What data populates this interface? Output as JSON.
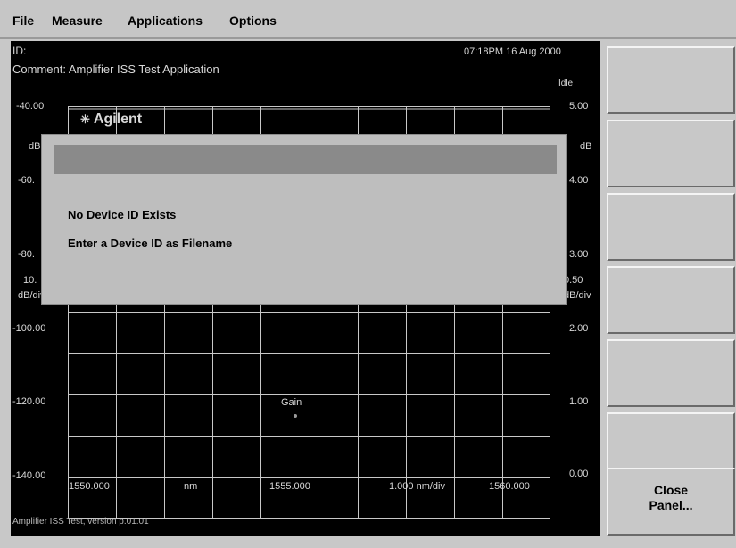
{
  "menu": {
    "file": "File",
    "measure": "Measure",
    "applications": "Applications",
    "options": "Options"
  },
  "header": {
    "id_label": "ID:",
    "comment": "Comment: Amplifier ISS Test Application",
    "datetime": "07:18PM 16 Aug 2000",
    "status": "Idle"
  },
  "left_axis": {
    "ticks": [
      "-40.00",
      "-60.",
      "-80.",
      "-100.00",
      "-120.00",
      "-140.00"
    ],
    "unit": "dB",
    "scale_value": "10.",
    "scale_unit": "dB/div"
  },
  "right_axis": {
    "ticks": [
      "5.00",
      "4.00",
      "3.00",
      "2.00",
      "1.00",
      "0.00"
    ],
    "unit": "dB",
    "scale_value": "0.50",
    "scale_unit": "dB/div"
  },
  "x_axis": {
    "start": "1550.000",
    "unit": "nm",
    "center": "1555.000",
    "scale": "1.000 nm/div",
    "end": "1560.000"
  },
  "trace_label": "Gain",
  "logo_text": "Agilent",
  "footer": "Amplifier ISS Test, version p.01.01",
  "dialog": {
    "title": "",
    "line1": "No Device ID Exists",
    "line2": "Enter a Device ID as Filename"
  },
  "softkeys": [
    "",
    "",
    "",
    "",
    "",
    "",
    "Close\nPanel..."
  ]
}
